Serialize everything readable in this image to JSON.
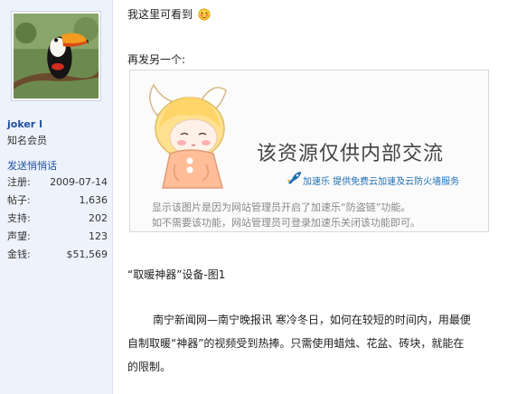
{
  "sidebar": {
    "username": "joker l",
    "rank": "知名会员",
    "pm_link": "发送悄悄话",
    "stats": [
      {
        "label": "注册:",
        "value": "2009-07-14"
      },
      {
        "label": "帖子:",
        "value": "1,636"
      },
      {
        "label": "支持:",
        "value": "202"
      },
      {
        "label": "声望:",
        "value": "123"
      },
      {
        "label": "金钱:",
        "value": "$51,569"
      }
    ],
    "avatar_icon": "toucan-avatar"
  },
  "post": {
    "line1": "我这里可看到",
    "line1_emoji": "blush-face-icon",
    "line2": "再发另一个:",
    "hotlink": {
      "title": "该资源仅供内部交流",
      "service": "加速乐  提供免费云加速及云防火墙服务",
      "note1": "显示该图片是因为网站管理员开启了加速乐“防盗链”功能。",
      "note2": "如不需要该功能，网站管理员可登录加速乐关闭该功能即可。"
    },
    "caption": "“取暖神器”设备-图1",
    "paragraph_line1": "南宁新闻网—南宁晚报讯 寒冷冬日，如何在较短的时间内，用最便",
    "paragraph_line2": "自制取暖“神器”的视频受到热捧。只需使用蜡烛、花盆、砖块，就能在",
    "paragraph_line3": "的限制。"
  },
  "colors": {
    "sidebar_bg": "#eef3fb",
    "link": "#1f4fa3",
    "service_blue": "#1f6fb3"
  }
}
